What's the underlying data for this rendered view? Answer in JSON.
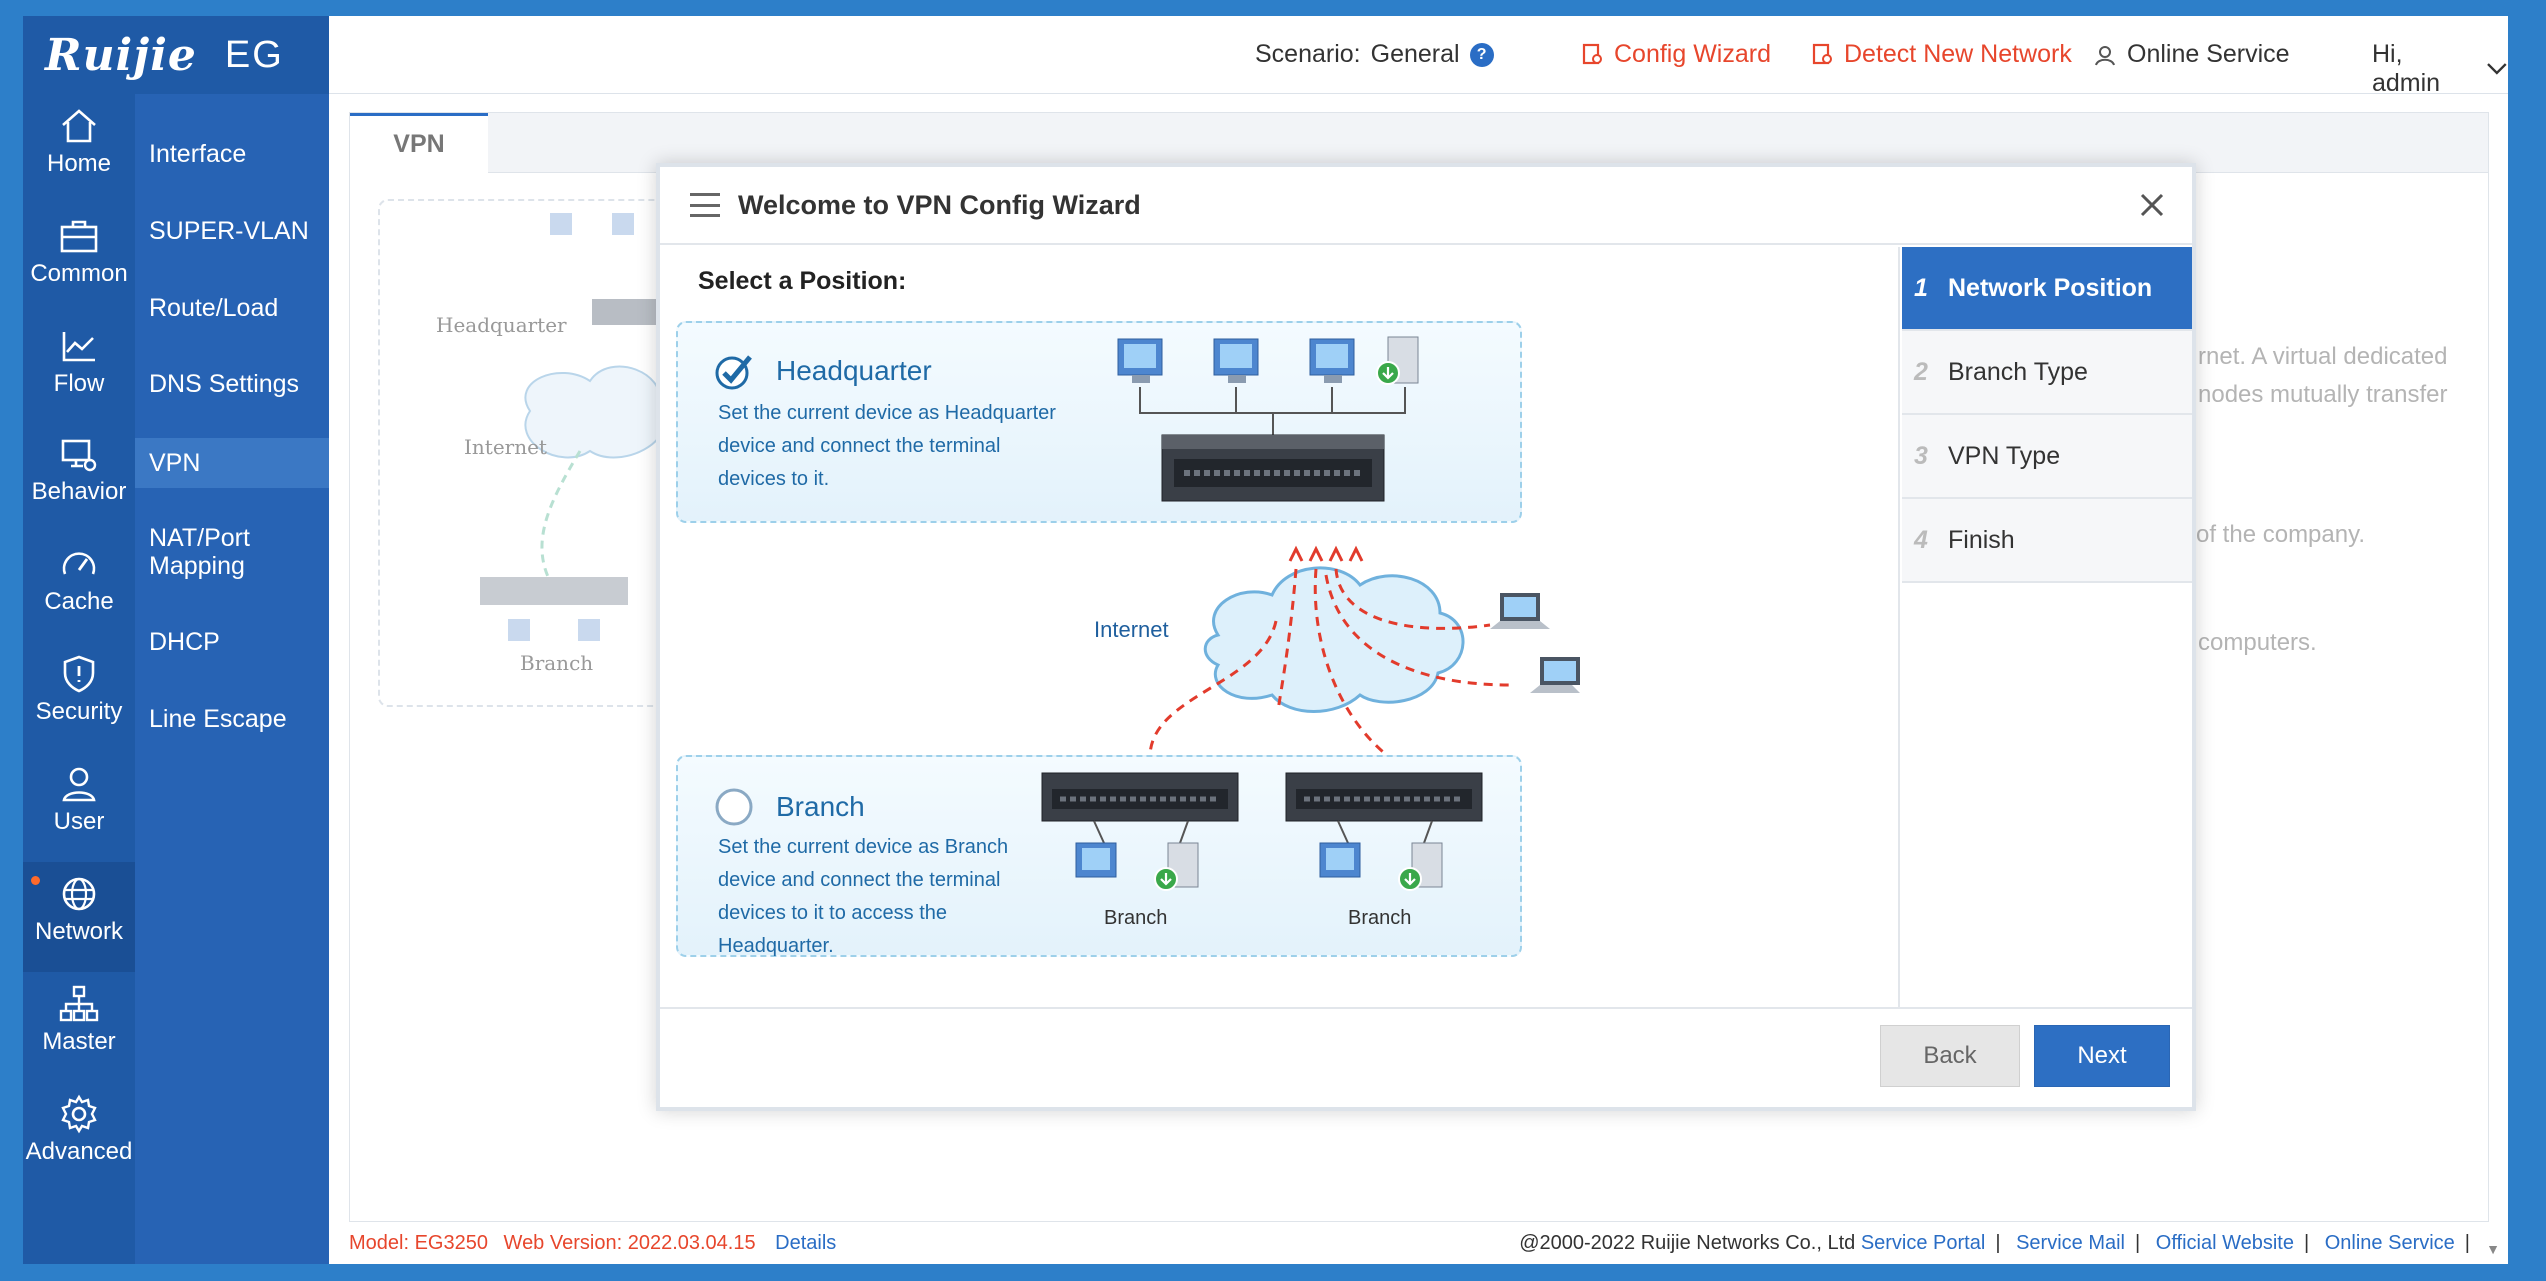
{
  "logo": {
    "brand": "Ruijie",
    "product": "EG"
  },
  "rail": [
    {
      "label": "Home",
      "icon": "home-icon"
    },
    {
      "label": "Common",
      "icon": "briefcase-icon"
    },
    {
      "label": "Flow",
      "icon": "line-chart-icon"
    },
    {
      "label": "Behavior",
      "icon": "monitor-eye-icon"
    },
    {
      "label": "Cache",
      "icon": "gauge-icon"
    },
    {
      "label": "Security",
      "icon": "shield-icon"
    },
    {
      "label": "User",
      "icon": "user-icon"
    },
    {
      "label": "Network",
      "icon": "globe-network-icon",
      "active": true
    },
    {
      "label": "Master",
      "icon": "hierarchy-icon"
    },
    {
      "label": "Advanced",
      "icon": "gear-icon"
    }
  ],
  "subnav": [
    {
      "label": "Interface"
    },
    {
      "label": "SUPER-VLAN"
    },
    {
      "label": "Route/Load"
    },
    {
      "label": "DNS Settings"
    },
    {
      "label": "VPN",
      "active": true
    },
    {
      "label": "NAT/Port Mapping"
    },
    {
      "label": "DHCP"
    },
    {
      "label": "Line Escape"
    }
  ],
  "header": {
    "scenario_label": "Scenario:",
    "scenario_value": "General",
    "config_wizard": "Config Wizard",
    "detect_network": "Detect New Network",
    "online_service": "Online Service",
    "greeting": "Hi, admin"
  },
  "content": {
    "tab": "VPN",
    "bg_diagram": {
      "hq": "Headquarter",
      "internet": "Internet",
      "branch": "Branch"
    },
    "bg_text": {
      "line1a": "rnet. A virtual dedicated",
      "line1b": "nodes mutually transfer",
      "line2": "of the company.",
      "line3": "computers."
    }
  },
  "modal": {
    "title": "Welcome to VPN Config Wizard",
    "select_title": "Select a Position:",
    "hq": {
      "title": "Headquarter",
      "desc": "Set the current device as Headquarter device and connect the terminal devices to it.",
      "selected": true
    },
    "internet_label": "Internet",
    "branch": {
      "title": "Branch",
      "desc": "Set the current device as Branch device and connect the terminal devices to it to access the Headquarter.",
      "selected": false,
      "device_label_1": "Branch",
      "device_label_2": "Branch"
    },
    "steps": [
      {
        "num": "1",
        "label": "Network Position",
        "active": true
      },
      {
        "num": "2",
        "label": "Branch Type"
      },
      {
        "num": "3",
        "label": "VPN Type"
      },
      {
        "num": "4",
        "label": "Finish"
      }
    ],
    "back": "Back",
    "next": "Next"
  },
  "footer": {
    "model_label": "Model:",
    "model_value": "EG3250",
    "web_label": "Web Version:",
    "web_value": "2022.03.04.15",
    "details": "Details",
    "copyright": "@2000-2022 Ruijie Networks Co., Ltd",
    "links": [
      "Service Portal",
      "Service Mail",
      "Official Website",
      "Online Service"
    ]
  },
  "colors": {
    "rail": "#1f5aa6",
    "subnav": "#2763b4",
    "accent": "#2d6fc3",
    "warning_link": "#e7462c"
  }
}
